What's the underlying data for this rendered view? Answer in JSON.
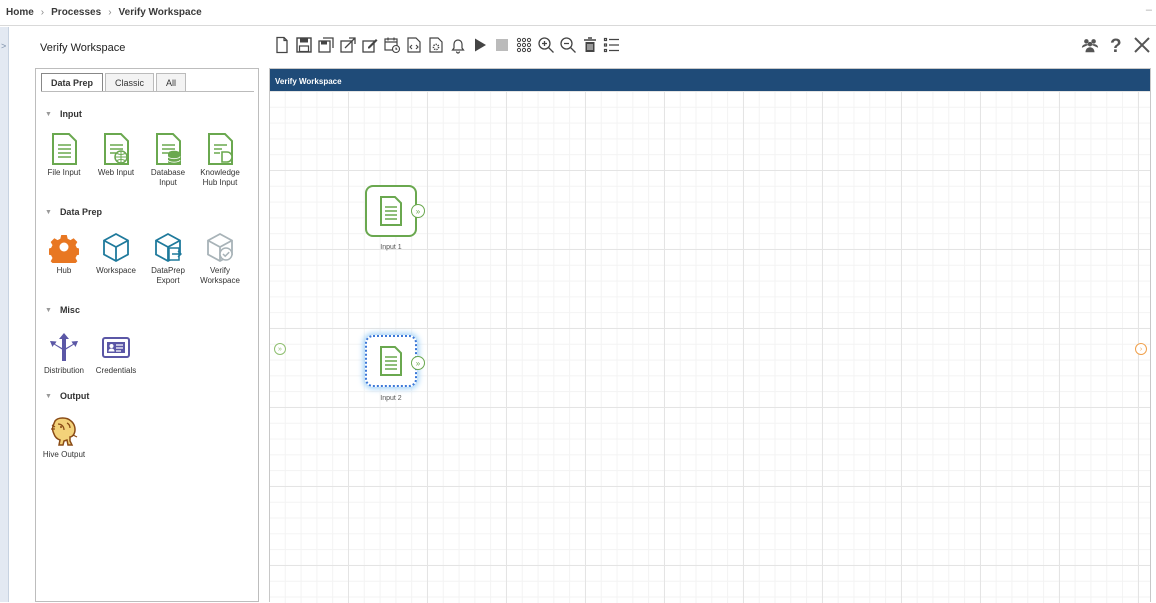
{
  "breadcrumb": {
    "items": [
      "Home",
      "Processes",
      "Verify Workspace"
    ],
    "separator": "›"
  },
  "process": {
    "title": "Verify Workspace"
  },
  "toolbar": {
    "icons": [
      "new-icon",
      "save-icon",
      "save-as-icon",
      "export-icon",
      "edit-icon",
      "schedule-icon",
      "code-icon",
      "settings-doc-icon",
      "bell-icon",
      "play-icon",
      "stop-icon",
      "grid-icon",
      "zoom-in-icon",
      "zoom-out-icon",
      "delete-icon",
      "list-icon"
    ],
    "right_icons": [
      "users-icon",
      "help-icon",
      "close-icon"
    ]
  },
  "palette": {
    "tabs": [
      {
        "label": "Data Prep",
        "active": true
      },
      {
        "label": "Classic",
        "active": false
      },
      {
        "label": "All",
        "active": false
      }
    ],
    "sections": {
      "input": {
        "title": "Input",
        "tools": [
          "File Input",
          "Web Input",
          "Database Input",
          "Knowledge Hub Input"
        ]
      },
      "dataprep": {
        "title": "Data Prep",
        "tools": [
          "Hub",
          "Workspace",
          "DataPrep Export",
          "Verify Workspace"
        ]
      },
      "misc": {
        "title": "Misc",
        "tools": [
          "Distribution",
          "Credentials"
        ]
      },
      "output": {
        "title": "Output",
        "tools": [
          "Hive Output"
        ]
      }
    }
  },
  "canvas": {
    "title": "Verify Workspace",
    "nodes": [
      {
        "label": "Input 1",
        "selected": false
      },
      {
        "label": "Input 2",
        "selected": true
      }
    ]
  },
  "colors": {
    "header_bg": "#1f4b78",
    "green": "#6aa84f",
    "teal": "#1f7a9c",
    "orange": "#e87722",
    "purple": "#5b57a6"
  }
}
